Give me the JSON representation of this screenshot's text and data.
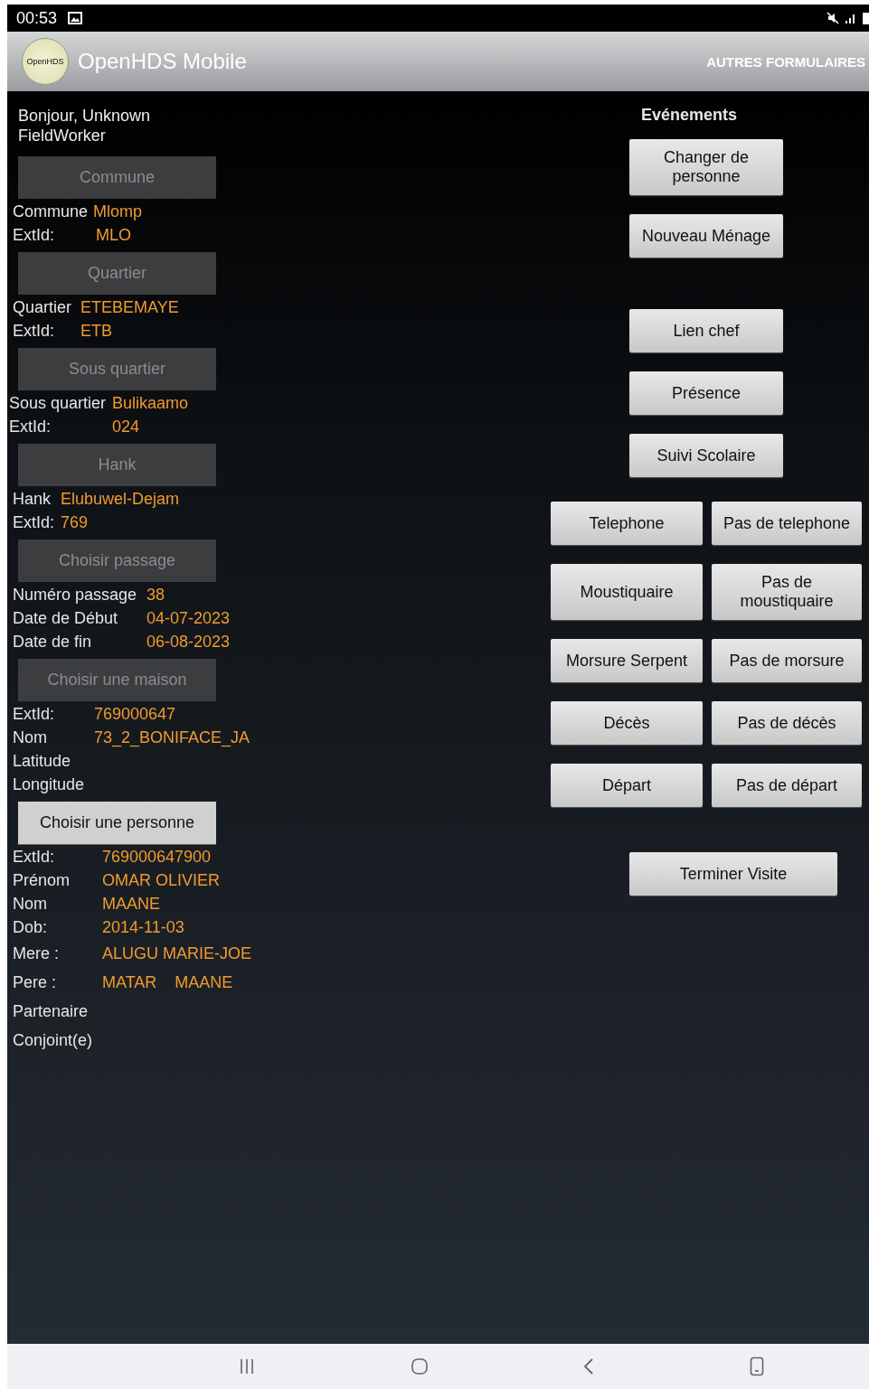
{
  "status_bar": {
    "time": "00:53"
  },
  "app_bar": {
    "logo": "OpenHDS",
    "title": "OpenHDS Mobile",
    "action": "AUTRES FORMULAIRES"
  },
  "greeting": "Bonjour, Unknown FieldWorker",
  "sections": [
    {
      "button": {
        "label": "Commune",
        "disabled": true
      },
      "rows": [
        {
          "label": "Commune",
          "value": "Mlomp"
        },
        {
          "label": "ExtId:",
          "value": "MLO"
        }
      ]
    },
    {
      "button": {
        "label": "Quartier",
        "disabled": true
      },
      "rows": [
        {
          "label": "Quartier",
          "value": "ETEBEMAYE"
        },
        {
          "label": "ExtId:",
          "value": "ETB"
        }
      ]
    },
    {
      "button": {
        "label": "Sous quartier",
        "disabled": true
      },
      "rows": [
        {
          "label": "Sous quartier",
          "value": "Bulikaamo"
        },
        {
          "label": "ExtId:",
          "value": "024"
        }
      ]
    },
    {
      "button": {
        "label": "Hank",
        "disabled": true
      },
      "rows": [
        {
          "label": "Hank",
          "value": "Elubuwel-Dejam"
        },
        {
          "label": "ExtId:",
          "value": "769"
        }
      ]
    },
    {
      "button": {
        "label": "Choisir passage",
        "disabled": true
      },
      "rows": [
        {
          "label": "Numéro passage",
          "value": "38"
        },
        {
          "label": "Date de Début",
          "value": "04-07-2023"
        },
        {
          "label": "Date de fin",
          "value": "06-08-2023"
        }
      ]
    },
    {
      "button": {
        "label": "Choisir une maison",
        "disabled": true
      },
      "rows": [
        {
          "label": "ExtId:",
          "value": "769000647"
        },
        {
          "label": "Nom",
          "value": "73_2_BONIFACE_JA"
        },
        {
          "label": "Latitude"
        },
        {
          "label": "Longitude"
        }
      ]
    },
    {
      "button": {
        "label": "Choisir une personne",
        "disabled": false
      },
      "rows": [
        {
          "label": "ExtId:",
          "value": "769000647900"
        },
        {
          "label": "Prénom",
          "value": "OMAR OLIVIER"
        },
        {
          "label": "Nom",
          "value": "MAANE"
        },
        {
          "label": "Dob:",
          "value": "2014-11-03"
        },
        {
          "label": "Mere :",
          "value": "ALUGU MARIE-JOE"
        },
        {
          "label": "Pere :",
          "value": "MATAR    MAANE"
        },
        {
          "label": "Partenaire"
        },
        {
          "label": "Conjoint(e)"
        }
      ]
    }
  ],
  "events": {
    "title": "Evénements",
    "rows": [
      [
        "Changer de personne"
      ],
      [
        "Nouveau Ménage"
      ],
      [
        "Lien chef"
      ],
      [
        "Présence"
      ],
      [
        "Suivi Scolaire"
      ],
      [
        "Telephone",
        "Pas de telephone"
      ],
      [
        "Moustiquaire",
        "Pas de moustiquaire"
      ],
      [
        "Morsure Serpent",
        "Pas de morsure"
      ],
      [
        "Décès",
        "Pas de décès"
      ],
      [
        "Départ",
        "Pas de départ"
      ],
      [
        "Terminer Visite"
      ]
    ]
  }
}
